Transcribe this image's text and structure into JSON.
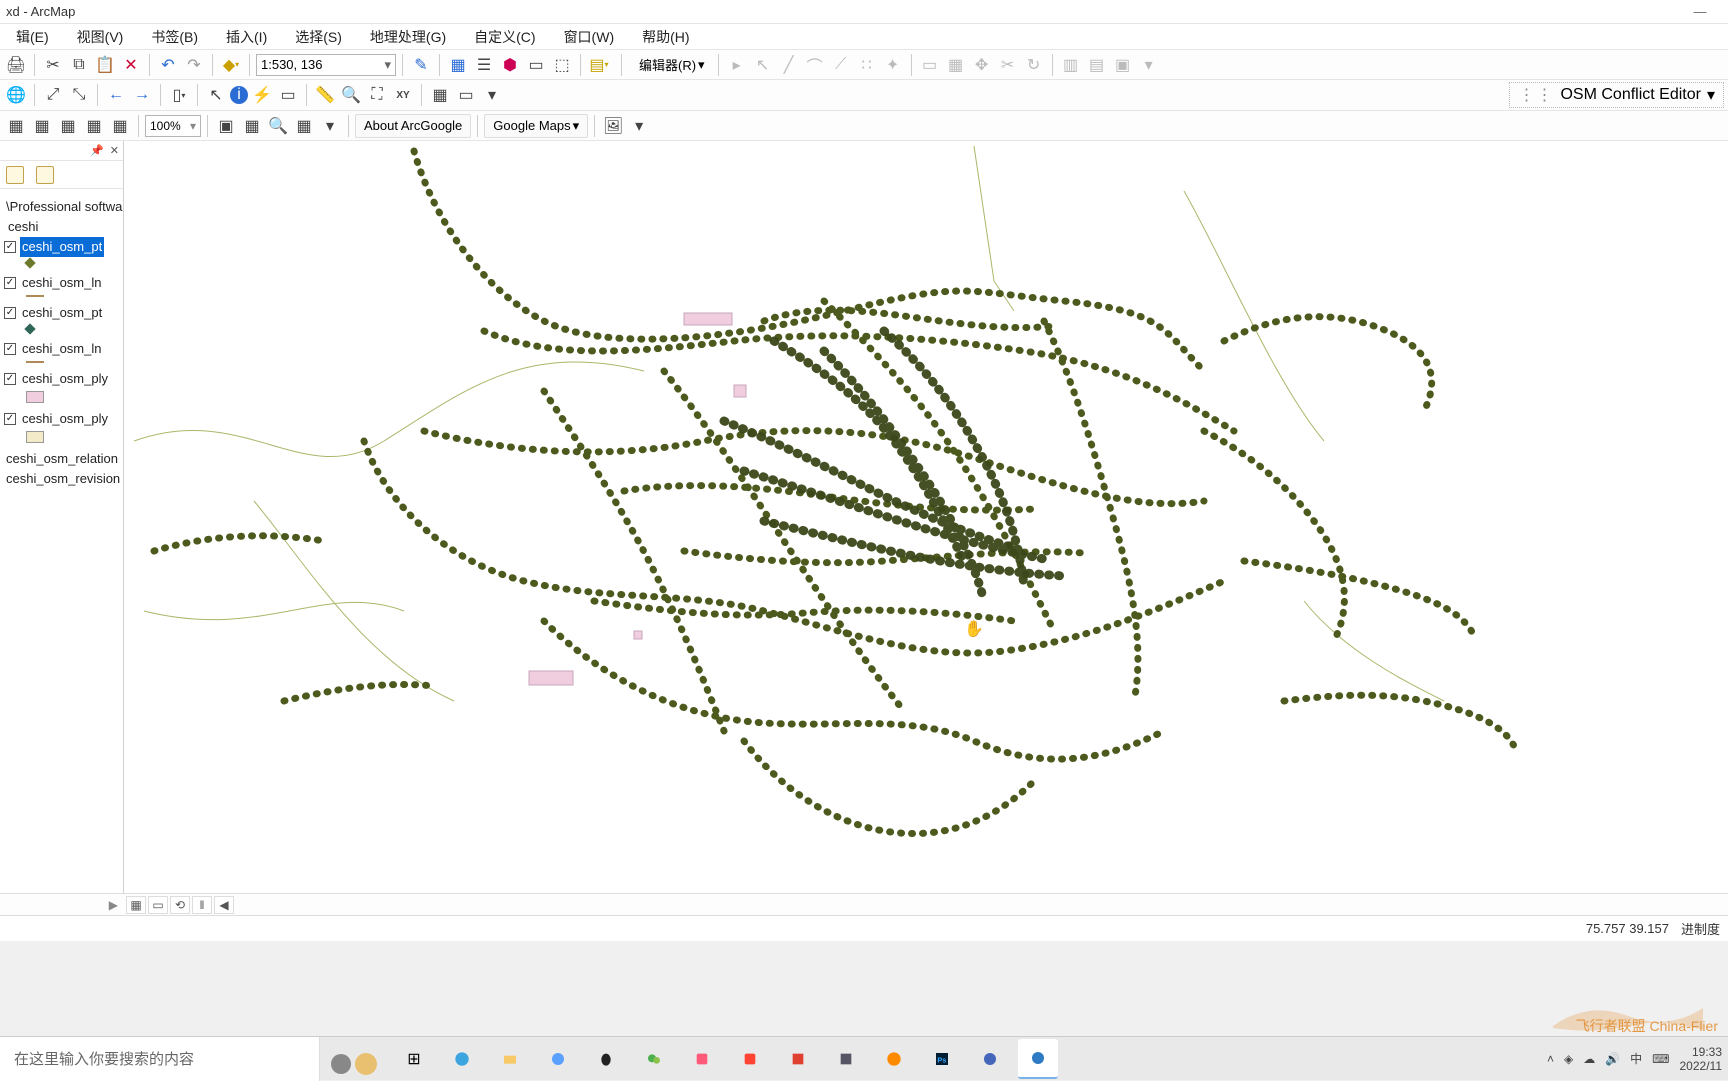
{
  "title": "xd - ArcMap",
  "menu": [
    "辑(E)",
    "视图(V)",
    "书签(B)",
    "插入(I)",
    "选择(S)",
    "地理处理(G)",
    "自定义(C)",
    "窗口(W)",
    "帮助(H)"
  ],
  "toolbar1": {
    "scale": "1:530, 136",
    "editor_label": "编辑器(R)"
  },
  "toolbar2": {
    "osm_label": "OSM Conflict Editor"
  },
  "toolbar3": {
    "zoom": "100%",
    "about_label": "About ArcGoogle",
    "gmaps_label": "Google Maps"
  },
  "toc": {
    "root1": "\\Professional softwar",
    "root2": "ceshi",
    "layers": [
      {
        "name": "ceshi_osm_pt",
        "checked": true,
        "selected": true,
        "sym": "pt"
      },
      {
        "name": "ceshi_osm_ln",
        "checked": true,
        "selected": false,
        "sym": "ln"
      },
      {
        "name": "ceshi_osm_pt",
        "checked": true,
        "selected": false,
        "sym": "pt2"
      },
      {
        "name": "ceshi_osm_ln",
        "checked": true,
        "selected": false,
        "sym": "ln"
      },
      {
        "name": "ceshi_osm_ply",
        "checked": true,
        "selected": false,
        "sym": "ply1"
      },
      {
        "name": "ceshi_osm_ply",
        "checked": true,
        "selected": false,
        "sym": "ply2"
      }
    ],
    "extra1": "ceshi_osm_relation",
    "extra2": "ceshi_osm_revision"
  },
  "status": {
    "coords": "75.757  39.157",
    "units": "进制度"
  },
  "taskbar": {
    "search_placeholder": "在这里输入你要搜索的内容",
    "ime": "中",
    "time": "19:33",
    "date": "2022/11"
  },
  "watermark": "飞行者联盟\nChina-Flier"
}
